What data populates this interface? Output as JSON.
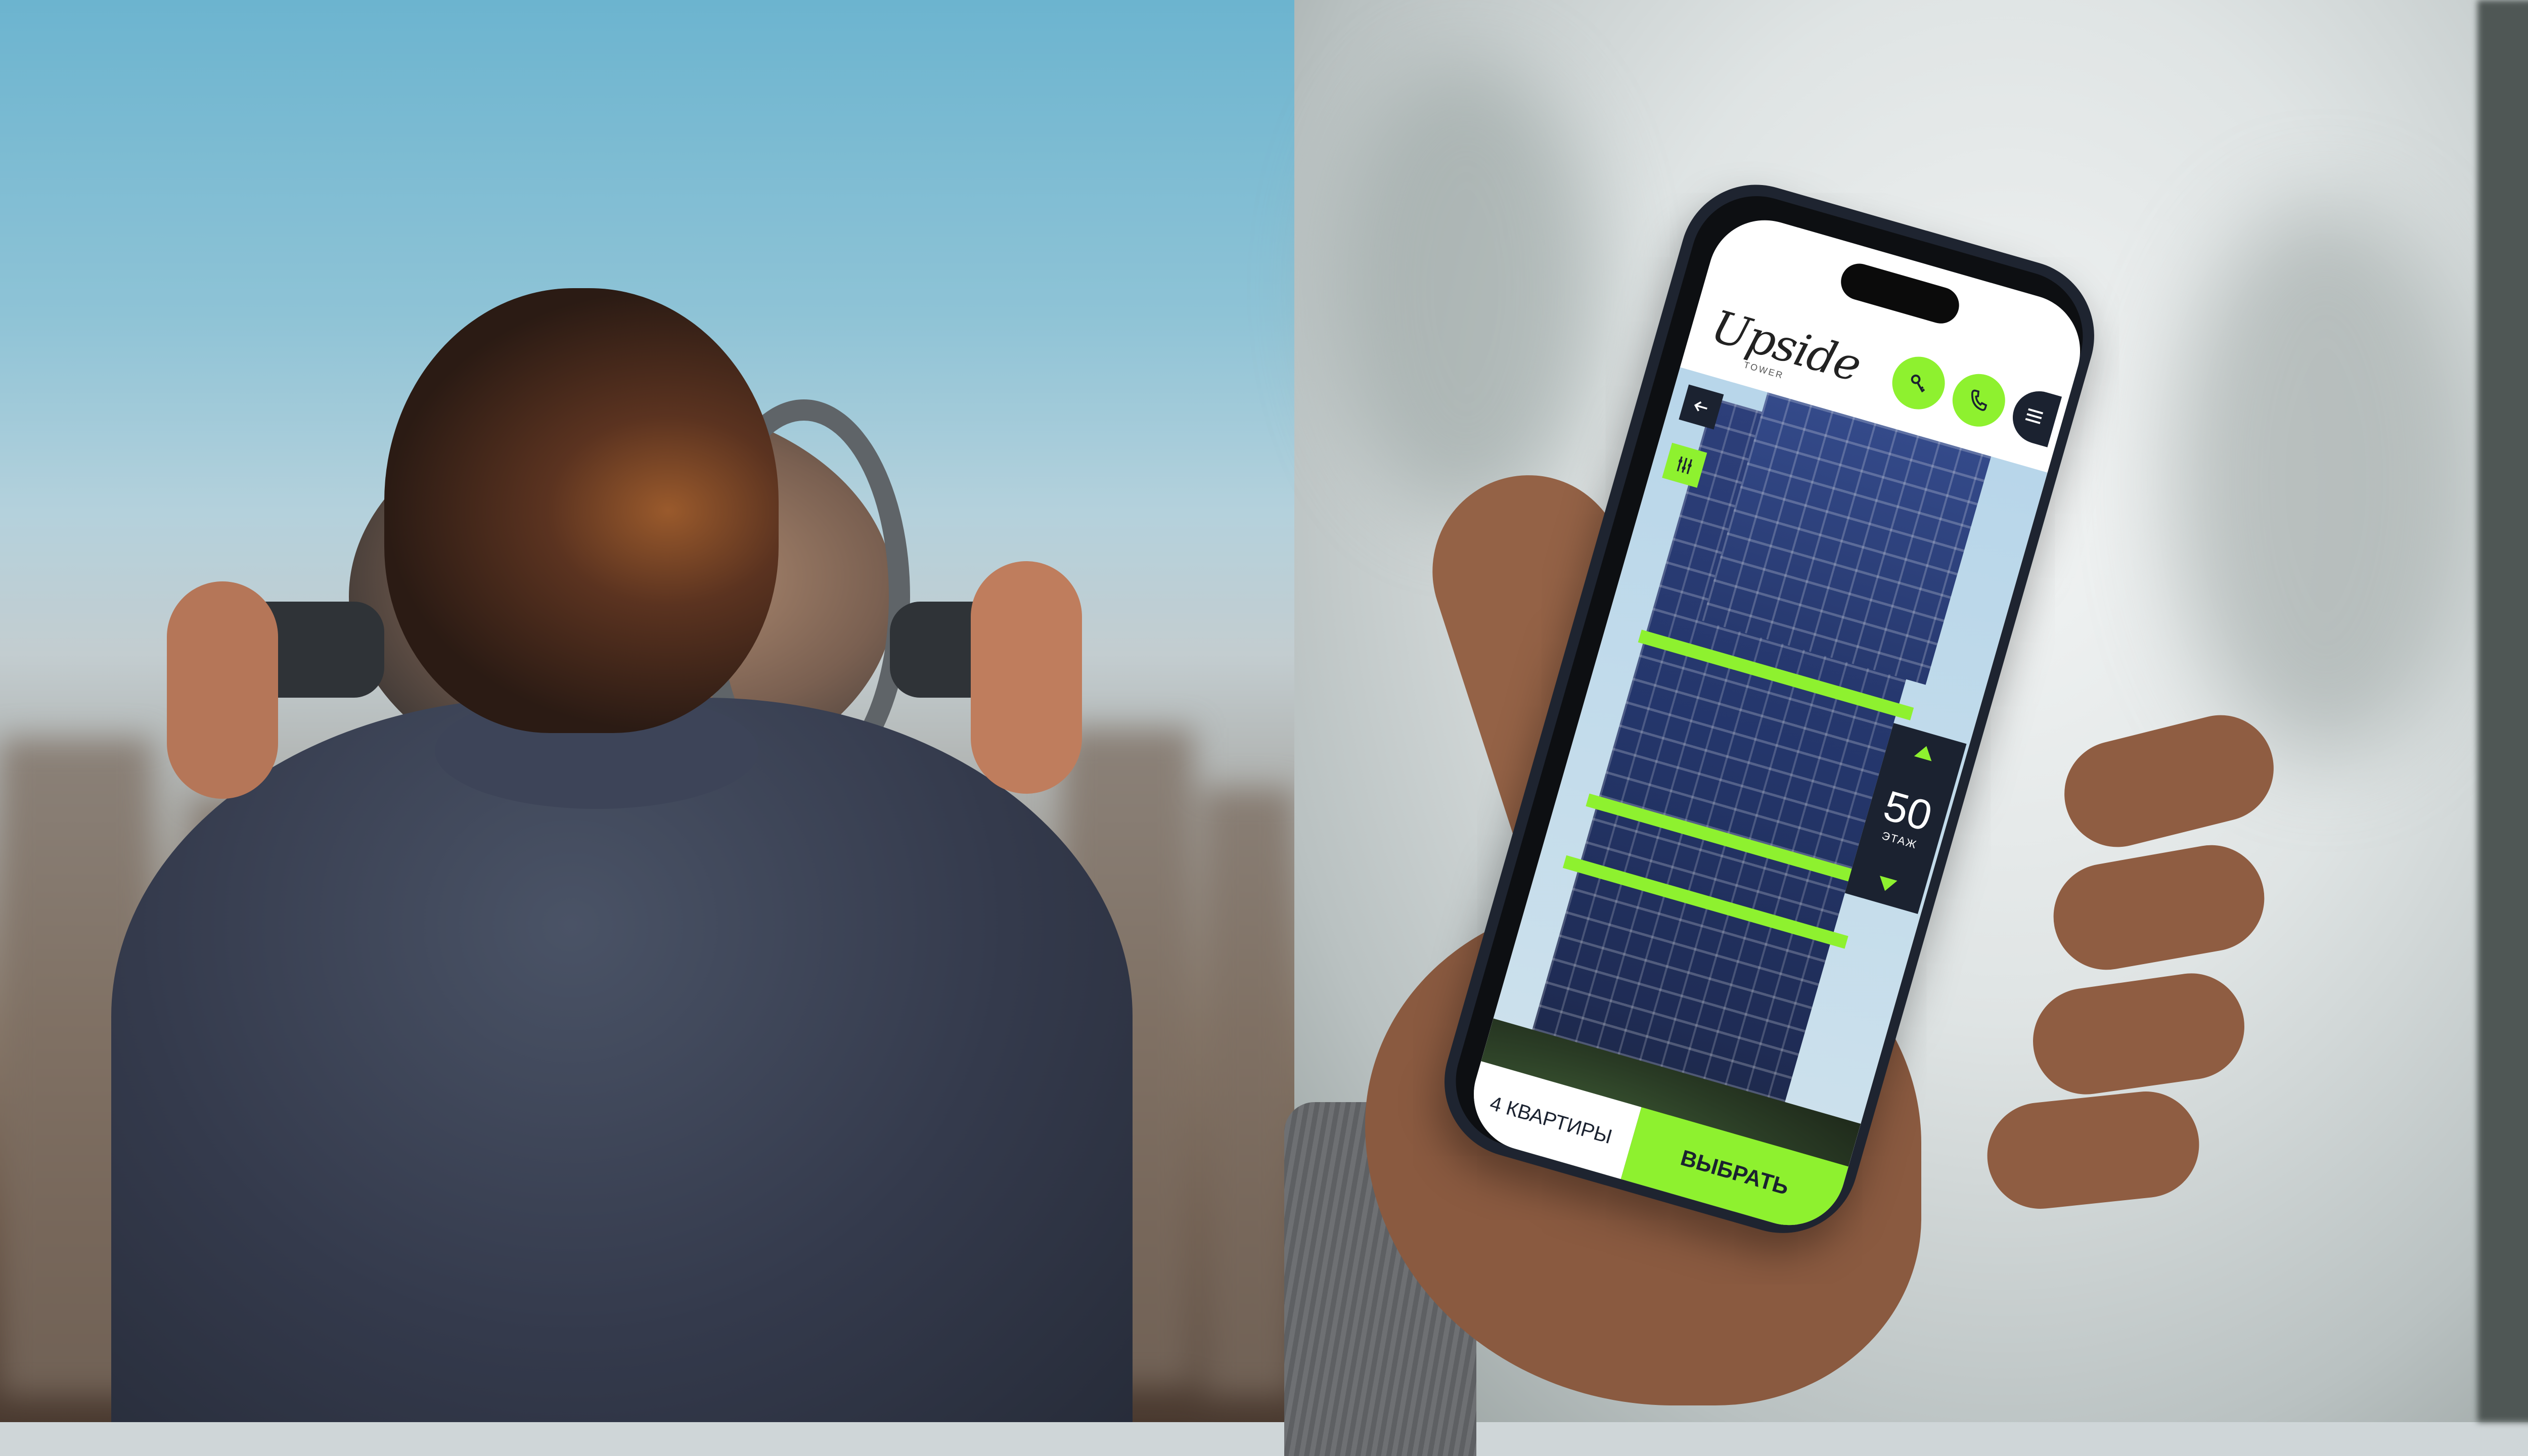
{
  "app": {
    "logo": "Upside",
    "logo_sub": "TOWER"
  },
  "header": {
    "key_icon": "key-icon",
    "phone_icon": "phone-icon",
    "menu_icon": "menu-icon"
  },
  "controls": {
    "back_icon": "arrow-left-icon",
    "filter_icon": "filter-sliders-icon"
  },
  "floor_picker": {
    "value": "50",
    "label": "ЭТАЖ"
  },
  "bottom_bar": {
    "count_label": "4 КВАРТИРЫ",
    "select_label": "ВЫБРАТЬ"
  },
  "colors": {
    "accent": "#8ef12f",
    "dark": "#1b2230"
  }
}
